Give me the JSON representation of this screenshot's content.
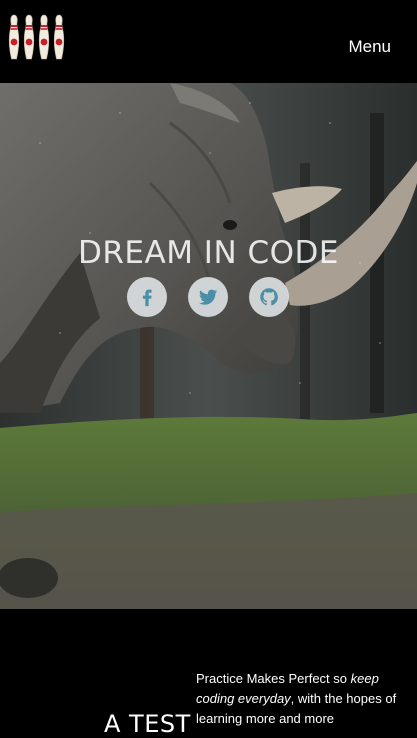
{
  "nav": {
    "menu_label": "Menu"
  },
  "hero": {
    "title": "DREAM IN CODE",
    "social": [
      "facebook-icon",
      "twitter-icon",
      "github-icon"
    ]
  },
  "section": {
    "title": "A TEST",
    "text_part1": "Practice Makes Perfect so ",
    "text_emph": "keep coding everyday",
    "text_part2": ", with the hopes of learning more and more"
  },
  "colors": {
    "nav_bg": "#000000",
    "icon_color": "#4a8fa6",
    "pin_red": "#c8202a"
  }
}
